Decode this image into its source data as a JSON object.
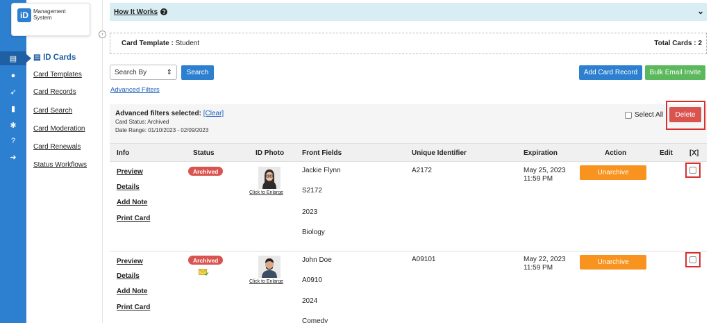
{
  "logo": {
    "mark": "iD",
    "text": "Management System"
  },
  "nav": {
    "title": "ID Cards",
    "items": [
      "Card Templates",
      "Card Records",
      "Card Search",
      "Card Moderation",
      "Card Renewals",
      "Status Workflows"
    ]
  },
  "how_it_works": {
    "label": "How It Works"
  },
  "template": {
    "label": "Card Template :",
    "value": "Student",
    "total_label": "Total Cards :",
    "total_value": "2"
  },
  "search": {
    "search_by": "Search By",
    "button": "Search",
    "advanced": "Advanced Filters"
  },
  "actions": {
    "add_card": "Add Card Record",
    "bulk_email": "Bulk Email Invite"
  },
  "filters": {
    "title": "Advanced filters selected:",
    "clear": "[Clear]",
    "status": "Card Status: Archived",
    "date_range": "Date Range: 01/10/2023 - 02/09/2023",
    "select_all": "Select All",
    "delete": "Delete"
  },
  "table": {
    "headers": [
      "Info",
      "Status",
      "ID Photo",
      "Front Fields",
      "Unique Identifier",
      "Expiration",
      "Action",
      "Edit",
      "[X]"
    ],
    "links": [
      "Preview",
      "Details",
      "Add Note",
      "Print Card"
    ],
    "enlarge": "Click to Enlarge",
    "action_label": "Unarchive",
    "rows": [
      {
        "status": "Archived",
        "front_fields": [
          "Jackie Flynn",
          "S2172",
          "2023",
          "Biology"
        ],
        "uid": "A2172",
        "exp_date": "May 25, 2023",
        "exp_time": "11:59 PM"
      },
      {
        "status": "Archived",
        "front_fields": [
          "John Doe",
          "A0910",
          "2024",
          "Comedy"
        ],
        "uid": "A09101",
        "exp_date": "May 22, 2023",
        "exp_time": "11:59 PM"
      }
    ]
  },
  "colors": {
    "rail": "#2d7fd0",
    "primary": "#2d7fd0",
    "success": "#5cb85c",
    "danger": "#d9534f",
    "warning": "#f7931e",
    "highlight": "#d92e2e"
  }
}
